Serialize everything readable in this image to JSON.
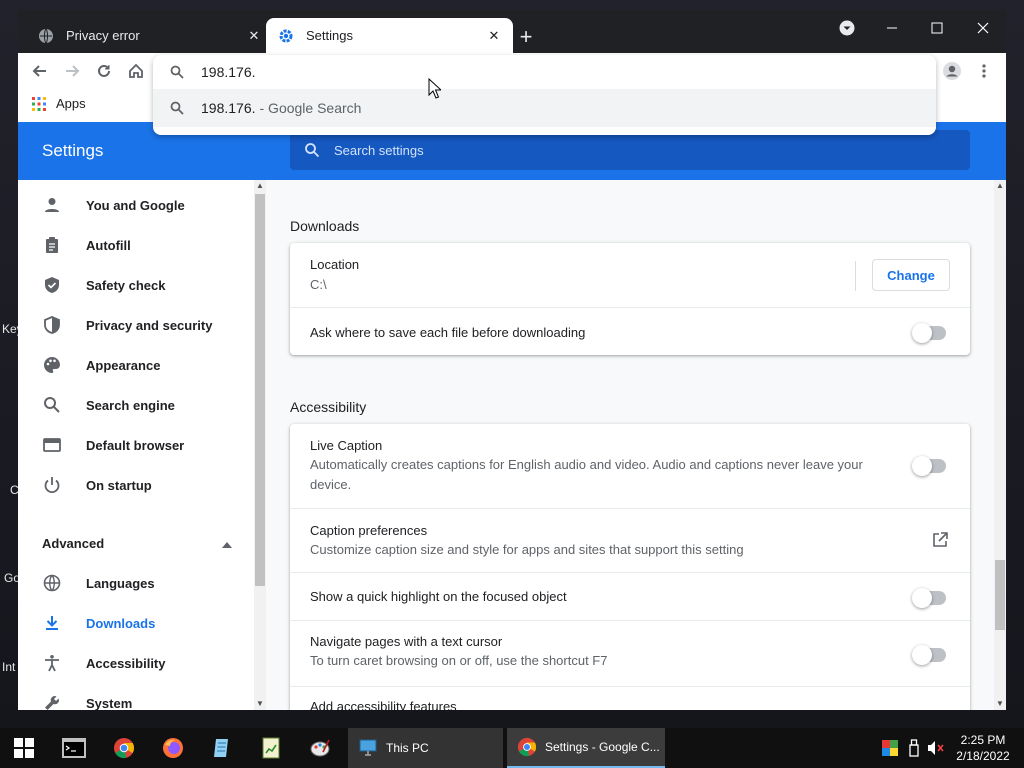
{
  "desktop": {
    "labels": [
      "Key",
      "C",
      "Go",
      "Int"
    ]
  },
  "browser": {
    "tabs": [
      {
        "title": "Privacy error",
        "active": false,
        "icon": "globe-icon"
      },
      {
        "title": "Settings",
        "active": true,
        "icon": "gear-icon"
      }
    ],
    "new_tab_label": "+",
    "bookmarks": {
      "apps_label": "Apps"
    },
    "omnibox": {
      "value": "198.176.",
      "suggestion_query": "198.176.",
      "suggestion_source": "- Google Search"
    }
  },
  "settings": {
    "title": "Settings",
    "search_placeholder": "Search settings",
    "sidebar": {
      "items": [
        {
          "label": "You and Google",
          "icon": "person-icon"
        },
        {
          "label": "Autofill",
          "icon": "clipboard-icon"
        },
        {
          "label": "Safety check",
          "icon": "shield-check-icon"
        },
        {
          "label": "Privacy and security",
          "icon": "shield-half-icon"
        },
        {
          "label": "Appearance",
          "icon": "palette-icon"
        },
        {
          "label": "Search engine",
          "icon": "search-icon"
        },
        {
          "label": "Default browser",
          "icon": "browser-icon"
        },
        {
          "label": "On startup",
          "icon": "power-icon"
        }
      ],
      "advanced_label": "Advanced",
      "advanced_items": [
        {
          "label": "Languages",
          "icon": "globe-icon"
        },
        {
          "label": "Downloads",
          "icon": "download-icon",
          "active": true
        },
        {
          "label": "Accessibility",
          "icon": "accessibility-icon"
        },
        {
          "label": "System",
          "icon": "wrench-icon"
        }
      ]
    },
    "downloads": {
      "section_title": "Downloads",
      "location_label": "Location",
      "location_value": "C:\\",
      "change_label": "Change",
      "ask_label": "Ask where to save each file before downloading",
      "ask_enabled": false
    },
    "accessibility": {
      "section_title": "Accessibility",
      "live_caption_title": "Live Caption",
      "live_caption_desc": "Automatically creates captions for English audio and video. Audio and captions never leave your device.",
      "live_caption_enabled": false,
      "caption_prefs_title": "Caption preferences",
      "caption_prefs_desc": "Customize caption size and style for apps and sites that support this setting",
      "highlight_title": "Show a quick highlight on the focused object",
      "highlight_enabled": false,
      "caret_title": "Navigate pages with a text cursor",
      "caret_desc": "To turn caret browsing on or off, use the shortcut F7",
      "caret_enabled": false,
      "add_features_title": "Add accessibility features"
    }
  },
  "taskbar": {
    "tasks": [
      {
        "label": "This PC"
      },
      {
        "label": "Settings - Google C..."
      }
    ],
    "time": "2:25 PM",
    "date": "2/18/2022"
  },
  "colors": {
    "accent": "#1a73e8",
    "tabstrip": "#202124",
    "taskbar": "#101010"
  }
}
